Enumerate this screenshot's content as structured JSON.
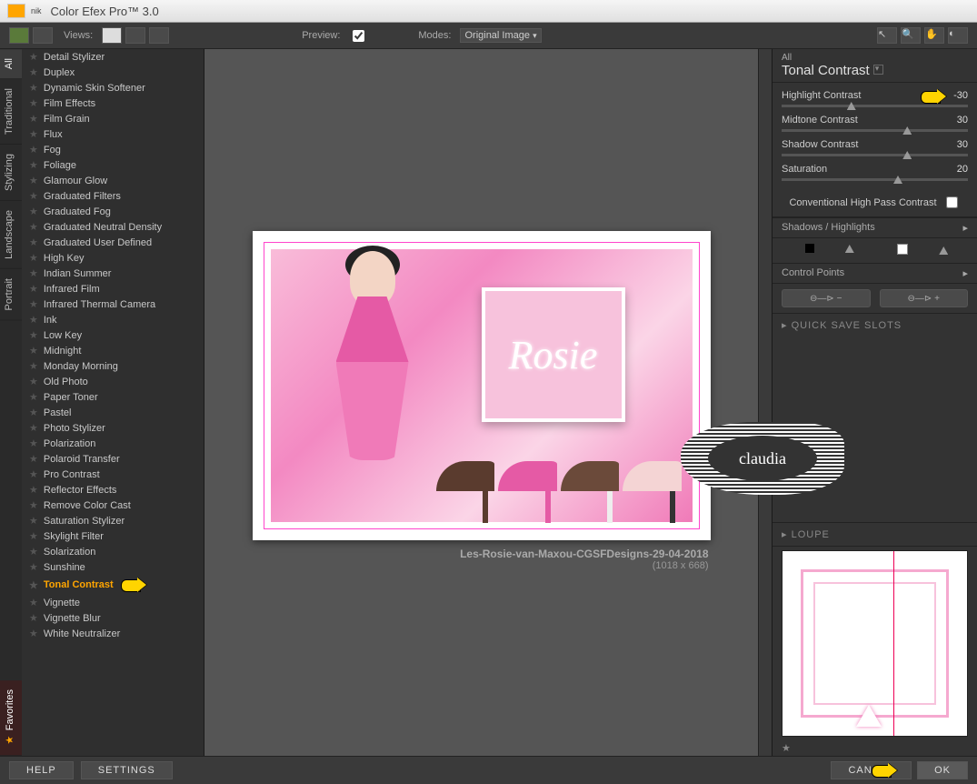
{
  "app": {
    "title": "Color Efex Pro™ 3.0",
    "brand": "nik"
  },
  "toolbar": {
    "views_label": "Views:",
    "preview_label": "Preview:",
    "preview_checked": true,
    "modes_label": "Modes:",
    "modes_value": "Original Image"
  },
  "sidetabs": [
    "All",
    "Traditional",
    "Stylizing",
    "Landscape",
    "Portrait"
  ],
  "sidetab_favorites": "Favorites",
  "filters": [
    "Detail Stylizer",
    "Duplex",
    "Dynamic Skin Softener",
    "Film Effects",
    "Film Grain",
    "Flux",
    "Fog",
    "Foliage",
    "Glamour Glow",
    "Graduated Filters",
    "Graduated Fog",
    "Graduated Neutral Density",
    "Graduated User Defined",
    "High Key",
    "Indian Summer",
    "Infrared Film",
    "Infrared Thermal Camera",
    "Ink",
    "Low Key",
    "Midnight",
    "Monday Morning",
    "Old Photo",
    "Paper Toner",
    "Pastel",
    "Photo Stylizer",
    "Polarization",
    "Polaroid Transfer",
    "Pro Contrast",
    "Reflector Effects",
    "Remove Color Cast",
    "Saturation Stylizer",
    "Skylight Filter",
    "Solarization",
    "Sunshine",
    "Tonal Contrast",
    "Vignette",
    "Vignette Blur",
    "White Neutralizer"
  ],
  "selected_filter": "Tonal Contrast",
  "preview": {
    "caption": "Les-Rosie-van-Maxou-CGSFDesigns-29-04-2018",
    "dims": "(1018 x 668)",
    "title_text": "Rosie",
    "watermark": "claudia"
  },
  "rpanel": {
    "category": "All",
    "title": "Tonal Contrast",
    "sliders": [
      {
        "label": "Highlight Contrast",
        "value": "-30",
        "pos": 35,
        "pointer": true
      },
      {
        "label": "Midtone Contrast",
        "value": "30",
        "pos": 65
      },
      {
        "label": "Shadow Contrast",
        "value": "30",
        "pos": 65
      },
      {
        "label": "Saturation",
        "value": "20",
        "pos": 60
      }
    ],
    "checkbox_label": "Conventional High Pass Contrast",
    "shadows_label": "Shadows / Highlights",
    "control_points_label": "Control Points",
    "quick_save": "QUICK SAVE SLOTS",
    "loupe_label": "LOUPE"
  },
  "footer": {
    "help": "HELP",
    "settings": "SETTINGS",
    "cancel": "CANCEL",
    "ok": "OK"
  }
}
